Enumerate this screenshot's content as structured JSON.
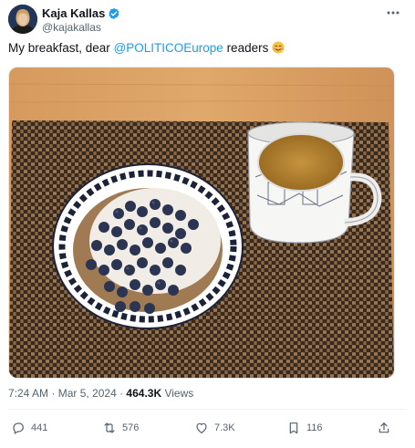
{
  "author": {
    "name": "Kaja Kallas",
    "handle": "@kajakallas"
  },
  "tweet": {
    "text_prefix": "My breakfast, dear ",
    "mention": "@POLITICOEurope",
    "text_suffix": " readers "
  },
  "meta": {
    "time": "7:24 AM",
    "sep1": " · ",
    "date": "Mar 5, 2024",
    "sep2": " · ",
    "views_count": "464.3K",
    "views_label": " Views"
  },
  "actions": {
    "replies": "441",
    "reposts": "576",
    "likes": "7.3K",
    "bookmarks": "116"
  },
  "icons": [
    "verified-badge-icon",
    "more-icon",
    "smiling-face-emoji",
    "reply-icon",
    "repost-icon",
    "like-icon",
    "bookmark-icon",
    "share-icon"
  ],
  "colors": {
    "accent": "#1d9bf0",
    "muted": "#536471",
    "text": "#0f1419"
  }
}
